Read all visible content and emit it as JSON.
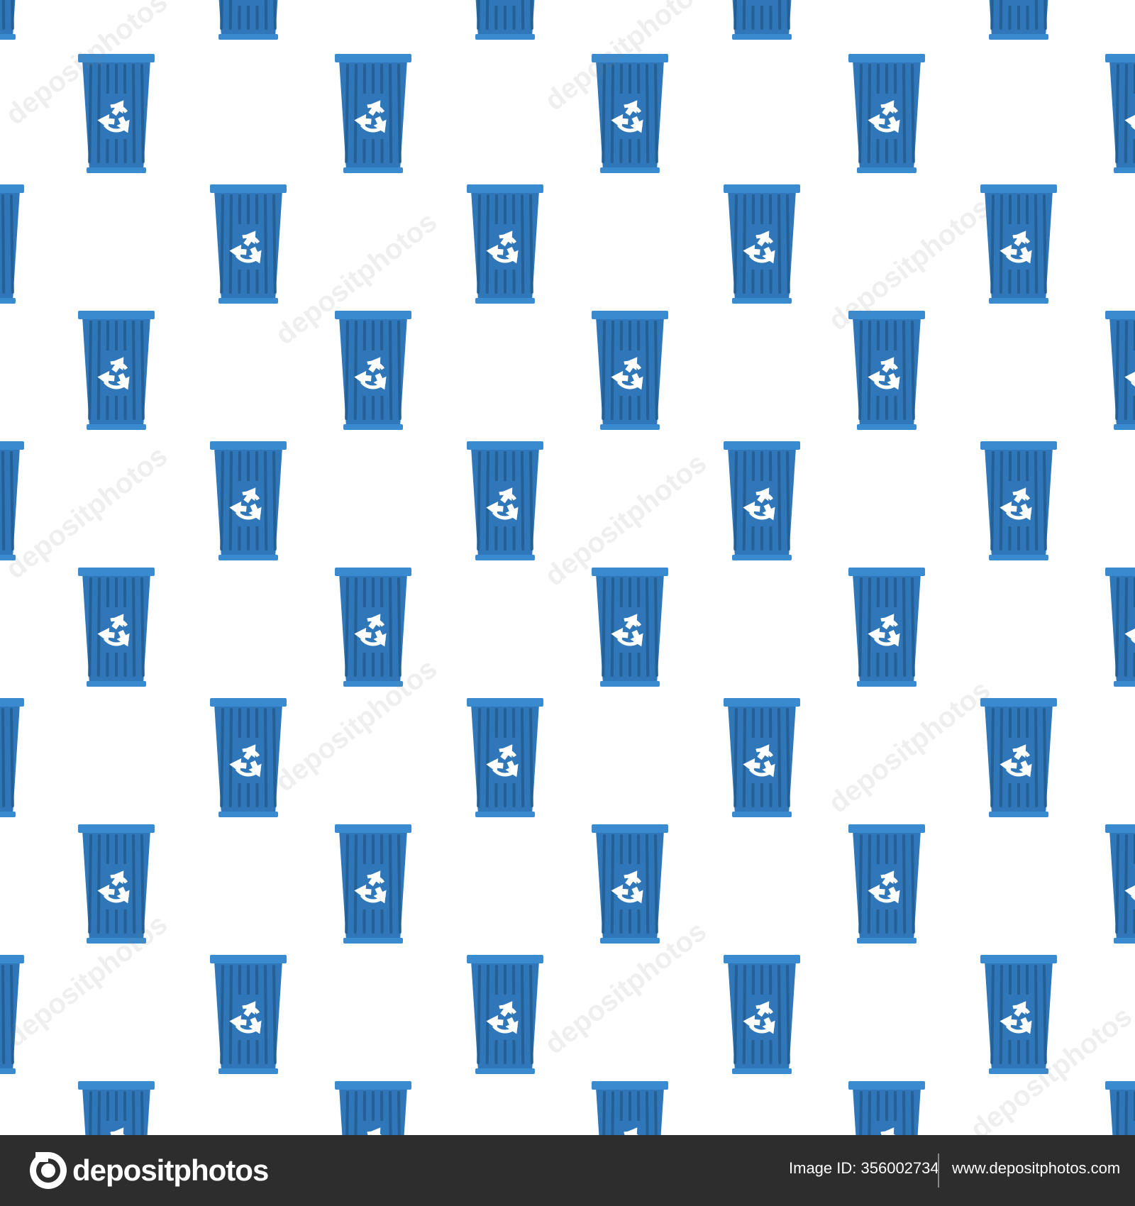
{
  "colors": {
    "background": "#ffffff",
    "bin_body": "#2f77b8",
    "bin_rim": "#3a8ad0",
    "bin_ridge": "#245f95",
    "symbol": "#ffffff",
    "footer_bg": "#2d2d2d",
    "footer_text": "#ffffff"
  },
  "pattern": {
    "icon": "recycle-bin-icon",
    "symbol": "recycle-symbol-icon",
    "watermark_text": "depositphotos"
  },
  "footer": {
    "brand_name": "depositphotos",
    "brand_icon": "depositphotos-logo-icon",
    "image_id_label": "Image ID:",
    "image_id": "356002734",
    "site_url": "www.depositphotos.com"
  }
}
